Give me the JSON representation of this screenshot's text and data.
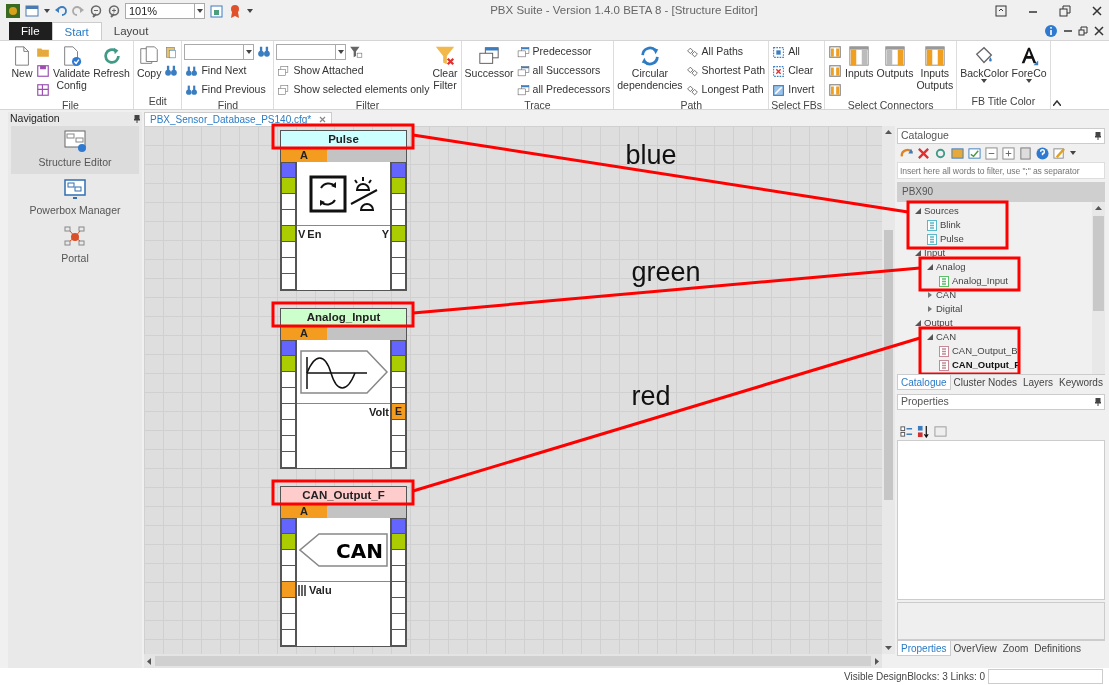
{
  "window": {
    "title": "PBX Suite - Version 1.4.0 BETA 8 - [Structure Editor]"
  },
  "quick_access": {
    "zoom": "101%"
  },
  "ribbon": {
    "tabs": [
      {
        "label": "File",
        "kind": "file",
        "selected": false
      },
      {
        "label": "Start",
        "kind": "tab",
        "selected": true
      },
      {
        "label": "Layout",
        "kind": "tab",
        "selected": false
      }
    ],
    "groups": [
      {
        "label": "File",
        "items": [
          {
            "kind": "large",
            "label": "New"
          },
          {
            "kind": "stack",
            "rows": [
              {
                "kind": "icon"
              },
              {
                "kind": "icon"
              },
              {
                "kind": "icon"
              }
            ]
          },
          {
            "kind": "large",
            "label": "Validate Config"
          },
          {
            "kind": "large",
            "label": "Refresh"
          }
        ]
      },
      {
        "label": "Edit",
        "items": [
          {
            "kind": "large",
            "label": "Copy"
          },
          {
            "kind": "stack",
            "rows": [
              {
                "kind": "icon"
              },
              {
                "kind": "icon"
              }
            ]
          }
        ]
      },
      {
        "label": "Find",
        "items": [
          {
            "kind": "stack",
            "rows": [
              {
                "kind": "combo"
              },
              {
                "kind": "small",
                "label": "Find Next"
              },
              {
                "kind": "small",
                "label": "Find Previous"
              }
            ]
          }
        ]
      },
      {
        "label": "Filter",
        "items": [
          {
            "kind": "stack",
            "rows": [
              {
                "kind": "combo"
              },
              {
                "kind": "small",
                "label": "Show Attached"
              },
              {
                "kind": "small",
                "label": "Show selected elements only"
              }
            ]
          },
          {
            "kind": "large",
            "label": "Clear Filter"
          }
        ]
      },
      {
        "label": "Trace",
        "items": [
          {
            "kind": "large",
            "label": "Successor"
          },
          {
            "kind": "stack",
            "rows": [
              {
                "kind": "small",
                "label": "Predecessor"
              },
              {
                "kind": "small",
                "label": "all Successors"
              },
              {
                "kind": "small",
                "label": "all Predecessors"
              }
            ]
          }
        ]
      },
      {
        "label": "Path",
        "items": [
          {
            "kind": "large",
            "label": "Circular dependencies"
          },
          {
            "kind": "stack",
            "rows": [
              {
                "kind": "small",
                "label": "All Paths"
              },
              {
                "kind": "small",
                "label": "Shortest Path"
              },
              {
                "kind": "small",
                "label": "Longest Path"
              }
            ]
          }
        ]
      },
      {
        "label": "Select FBs",
        "items": [
          {
            "kind": "stack",
            "rows": [
              {
                "kind": "small",
                "label": "All"
              },
              {
                "kind": "small",
                "label": "Clear"
              },
              {
                "kind": "small",
                "label": "Invert"
              }
            ]
          }
        ]
      },
      {
        "label": "Select Connectors",
        "items": [
          {
            "kind": "stack",
            "rows": [
              {
                "kind": "icon"
              },
              {
                "kind": "icon"
              },
              {
                "kind": "icon"
              }
            ]
          },
          {
            "kind": "large",
            "label": "Inputs"
          },
          {
            "kind": "large",
            "label": "Outputs"
          },
          {
            "kind": "large",
            "label": "Inputs Outputs"
          }
        ]
      },
      {
        "label": "FB Title Color",
        "items": [
          {
            "kind": "large",
            "label": "BackColor",
            "dropdown": true
          },
          {
            "kind": "large",
            "label": "ForeCo",
            "dropdown": true
          }
        ]
      }
    ]
  },
  "navigation": {
    "title": "Navigation",
    "items": [
      {
        "label": "Structure Editor",
        "selected": true
      },
      {
        "label": "Powerbox Manager",
        "selected": false
      },
      {
        "label": "Portal",
        "selected": false
      }
    ]
  },
  "document_tab": {
    "label": "PBX_Sensor_Database_PS140.cfg*"
  },
  "blocks": [
    {
      "title": "Pulse",
      "color": "#ccffff",
      "header": "A",
      "symbol": {
        "kind": "pulse"
      },
      "left_pins": [
        {
          "color": "#6464ff"
        },
        {
          "color": "#aacc00"
        },
        {
          "color": "#ffffff"
        },
        {
          "color": "#ffffff"
        },
        {
          "color": "#aacc00"
        },
        {
          "color": "#ffffff"
        },
        {
          "color": "#ffffff"
        },
        {
          "color": "#ffffff"
        }
      ],
      "right_pins": [
        {
          "color": "#6464ff"
        },
        {
          "color": "#aacc00"
        },
        {
          "color": "#ffffff"
        },
        {
          "color": "#ffffff"
        },
        {
          "color": "#aacc00"
        },
        {
          "color": "#ffffff"
        },
        {
          "color": "#ffffff"
        },
        {
          "color": "#ffffff"
        }
      ],
      "io": {
        "left_mark": "V",
        "left_label": "En",
        "right_label": "Y"
      }
    },
    {
      "title": "Analog_Input",
      "color": "#ccffcc",
      "header": "A",
      "symbol": {
        "kind": "analog"
      },
      "left_pins": [
        {
          "color": "#6464ff"
        },
        {
          "color": "#aacc00"
        },
        {
          "color": "#ffffff"
        },
        {
          "color": "#ffffff"
        },
        {
          "color": "#ffffff"
        },
        {
          "color": "#ffffff"
        },
        {
          "color": "#ffffff"
        },
        {
          "color": "#ffffff"
        }
      ],
      "right_pins": [
        {
          "color": "#6464ff"
        },
        {
          "color": "#aacc00"
        },
        {
          "color": "#ffffff"
        },
        {
          "color": "#ffffff"
        },
        {
          "color": "#f39c1f",
          "text": "E"
        },
        {
          "color": "#ffffff"
        },
        {
          "color": "#ffffff"
        },
        {
          "color": "#ffffff"
        }
      ],
      "io": {
        "right_label": "Volt"
      }
    },
    {
      "title": "CAN_Output_F",
      "color": "#ffcccc",
      "header": "A",
      "symbol": {
        "kind": "can",
        "text": "CAN"
      },
      "left_pins": [
        {
          "color": "#6464ff"
        },
        {
          "color": "#aacc00"
        },
        {
          "color": "#ffffff"
        },
        {
          "color": "#ffffff"
        },
        {
          "color": "#f39c1f"
        },
        {
          "color": "#ffffff"
        },
        {
          "color": "#ffffff"
        },
        {
          "color": "#ffffff"
        }
      ],
      "right_pins": [
        {
          "color": "#6464ff"
        },
        {
          "color": "#aacc00"
        },
        {
          "color": "#ffffff"
        },
        {
          "color": "#ffffff"
        },
        {
          "color": "#ffffff"
        },
        {
          "color": "#ffffff"
        },
        {
          "color": "#ffffff"
        },
        {
          "color": "#ffffff"
        }
      ],
      "io": {
        "left_label": "Valu",
        "left_bars": true
      }
    }
  ],
  "catalogue": {
    "title": "Catalogue",
    "filter_placeholder": "Insert here all words to filter, use \";\" as separator",
    "header": "PBX90",
    "tree": [
      {
        "label": "Sources",
        "expanded": true,
        "annotated": true,
        "selected": false,
        "children": [
          {
            "label": "Blink",
            "color": "#5bb8c8",
            "selected": false
          },
          {
            "label": "Pulse",
            "color": "#5bb8c8",
            "selected": false
          }
        ]
      },
      {
        "label": "Input",
        "expanded": true,
        "annotated": false,
        "selected": false,
        "children": [
          {
            "label": "Analog",
            "expanded": true,
            "annotated": true,
            "selected": false,
            "children": [
              {
                "label": "Analog_Input",
                "color": "#5cbf6a",
                "selected": false
              }
            ]
          },
          {
            "label": "CAN",
            "expanded": false,
            "annotated": false,
            "selected": false
          },
          {
            "label": "Digital",
            "expanded": false,
            "annotated": false,
            "selected": false
          }
        ]
      },
      {
        "label": "Output",
        "expanded": true,
        "annotated": false,
        "selected": false,
        "children": [
          {
            "label": "CAN",
            "expanded": true,
            "annotated": true,
            "selected": false,
            "children": [
              {
                "label": "CAN_Output_B",
                "color": "#c48a98",
                "selected": false
              },
              {
                "label": "CAN_Output_F",
                "color": "#c48a98",
                "selected": true
              }
            ]
          }
        ]
      }
    ],
    "tabs": [
      {
        "label": "Catalogue",
        "selected": true
      },
      {
        "label": "Cluster Nodes",
        "selected": false
      },
      {
        "label": "Layers",
        "selected": false
      },
      {
        "label": "Keywords",
        "selected": false
      }
    ]
  },
  "properties": {
    "title": "Properties",
    "tabs": [
      {
        "label": "Properties",
        "selected": true
      },
      {
        "label": "OverView",
        "selected": false
      },
      {
        "label": "Zoom",
        "selected": false
      },
      {
        "label": "Definitions",
        "selected": false
      }
    ]
  },
  "annotations": [
    {
      "label": "blue"
    },
    {
      "label": "green"
    },
    {
      "label": "red"
    }
  ],
  "status_bar": {
    "text": "Visible DesignBlocks: 3 Links: 0"
  }
}
